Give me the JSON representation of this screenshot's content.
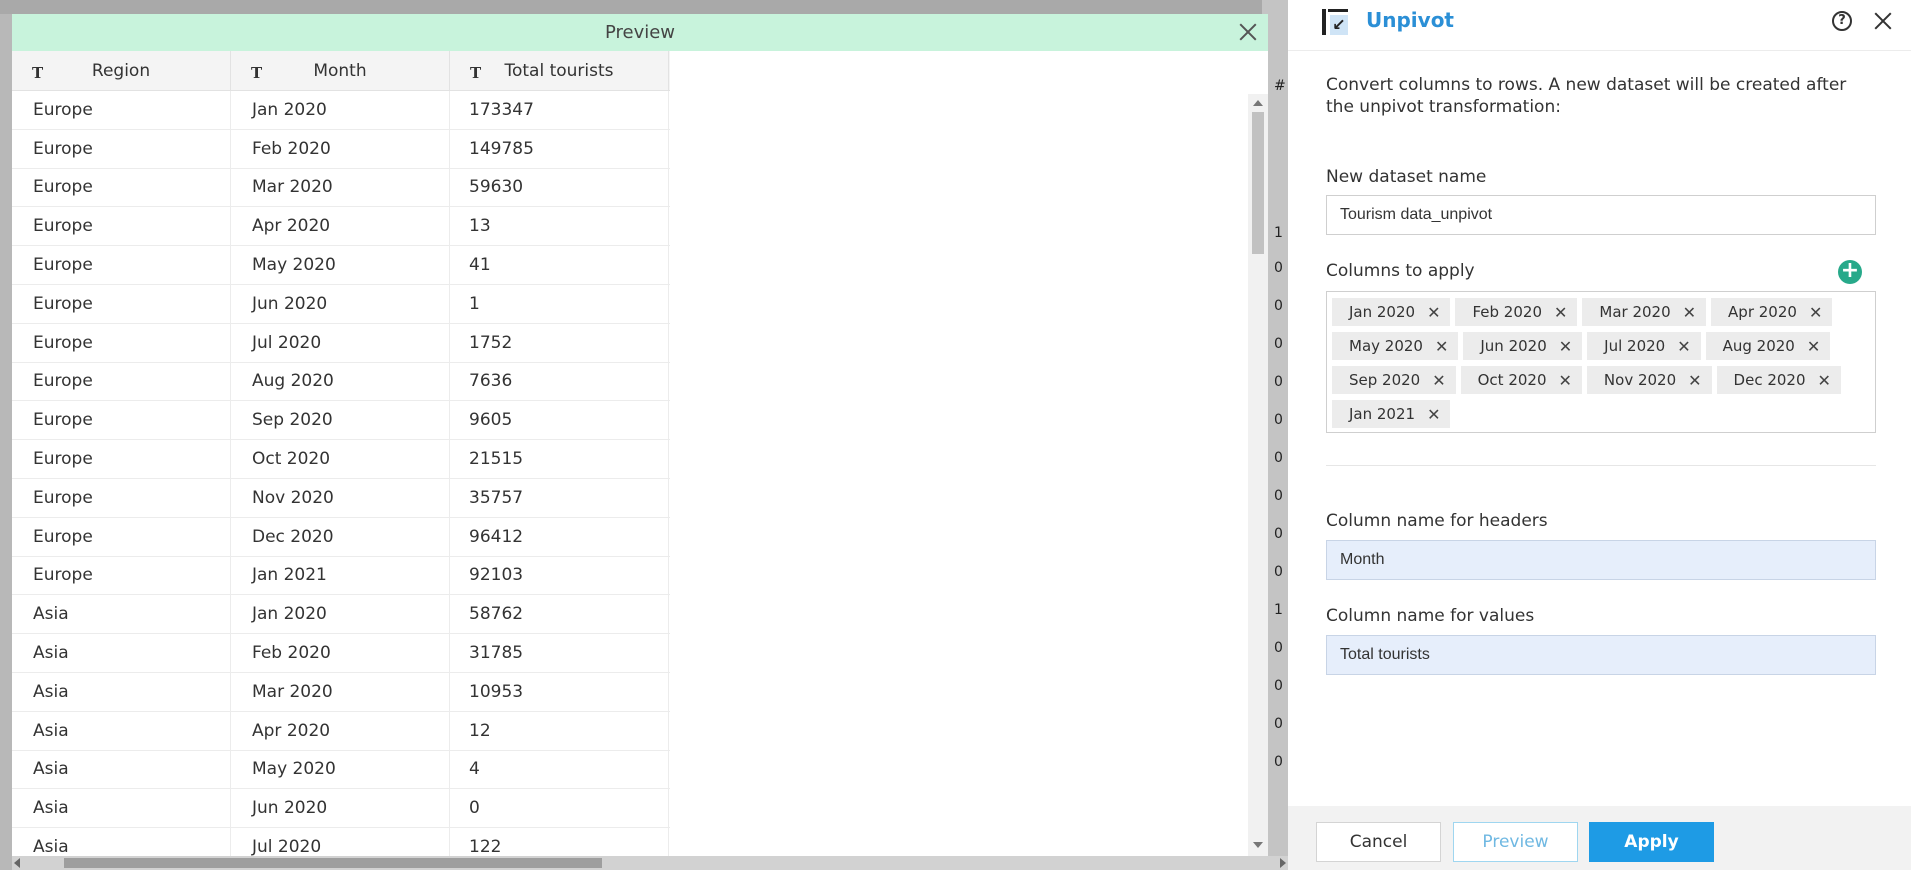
{
  "background": {
    "hash_glyph": "#",
    "cells": [
      "1",
      "0",
      "0",
      "0",
      "0",
      "0",
      "0",
      "0",
      "0",
      "0",
      "1",
      "0",
      "0",
      "0",
      "0"
    ]
  },
  "preview": {
    "title": "Preview",
    "columns": [
      {
        "type_icon": "T",
        "label": "Region"
      },
      {
        "type_icon": "T",
        "label": "Month"
      },
      {
        "type_icon": "T",
        "label": "Total tourists"
      }
    ],
    "rows": [
      [
        "Europe",
        "Jan 2020",
        "173347"
      ],
      [
        "Europe",
        "Feb 2020",
        "149785"
      ],
      [
        "Europe",
        "Mar 2020",
        "59630"
      ],
      [
        "Europe",
        "Apr 2020",
        "13"
      ],
      [
        "Europe",
        "May 2020",
        "41"
      ],
      [
        "Europe",
        "Jun 2020",
        "1"
      ],
      [
        "Europe",
        "Jul 2020",
        "1752"
      ],
      [
        "Europe",
        "Aug 2020",
        "7636"
      ],
      [
        "Europe",
        "Sep 2020",
        "9605"
      ],
      [
        "Europe",
        "Oct 2020",
        "21515"
      ],
      [
        "Europe",
        "Nov 2020",
        "35757"
      ],
      [
        "Europe",
        "Dec 2020",
        "96412"
      ],
      [
        "Europe",
        "Jan 2021",
        "92103"
      ],
      [
        "Asia",
        "Jan 2020",
        "58762"
      ],
      [
        "Asia",
        "Feb 2020",
        "31785"
      ],
      [
        "Asia",
        "Mar 2020",
        "10953"
      ],
      [
        "Asia",
        "Apr 2020",
        "12"
      ],
      [
        "Asia",
        "May 2020",
        "4"
      ],
      [
        "Asia",
        "Jun 2020",
        "0"
      ],
      [
        "Asia",
        "Jul 2020",
        "122"
      ]
    ]
  },
  "panel": {
    "title": "Unpivot",
    "logo_glyph": "↙",
    "help_glyph": "?",
    "description": "Convert columns to rows. A new dataset will be created after the unpivot transformation:",
    "dataset_name_label": "New dataset name",
    "dataset_name_value": "Tourism data_unpivot",
    "columns_label": "Columns to apply",
    "add_glyph": "+",
    "tag_remove_glyph": "✕",
    "tags": [
      "Jan 2020",
      "Feb 2020",
      "Mar 2020",
      "Apr 2020",
      "May 2020",
      "Jun 2020",
      "Jul 2020",
      "Aug 2020",
      "Sep 2020",
      "Oct 2020",
      "Nov 2020",
      "Dec 2020",
      "Jan 2021"
    ],
    "headers_label": "Column name for headers",
    "headers_value": "Month",
    "values_label": "Column name for values",
    "values_value": "Total tourists",
    "buttons": {
      "cancel": "Cancel",
      "preview": "Preview",
      "apply": "Apply"
    }
  },
  "colors": {
    "preview_header": "#c8f3dc",
    "accent_blue": "#1e9be5",
    "title_blue": "#2b8fd6",
    "add_green": "#27a98a"
  }
}
